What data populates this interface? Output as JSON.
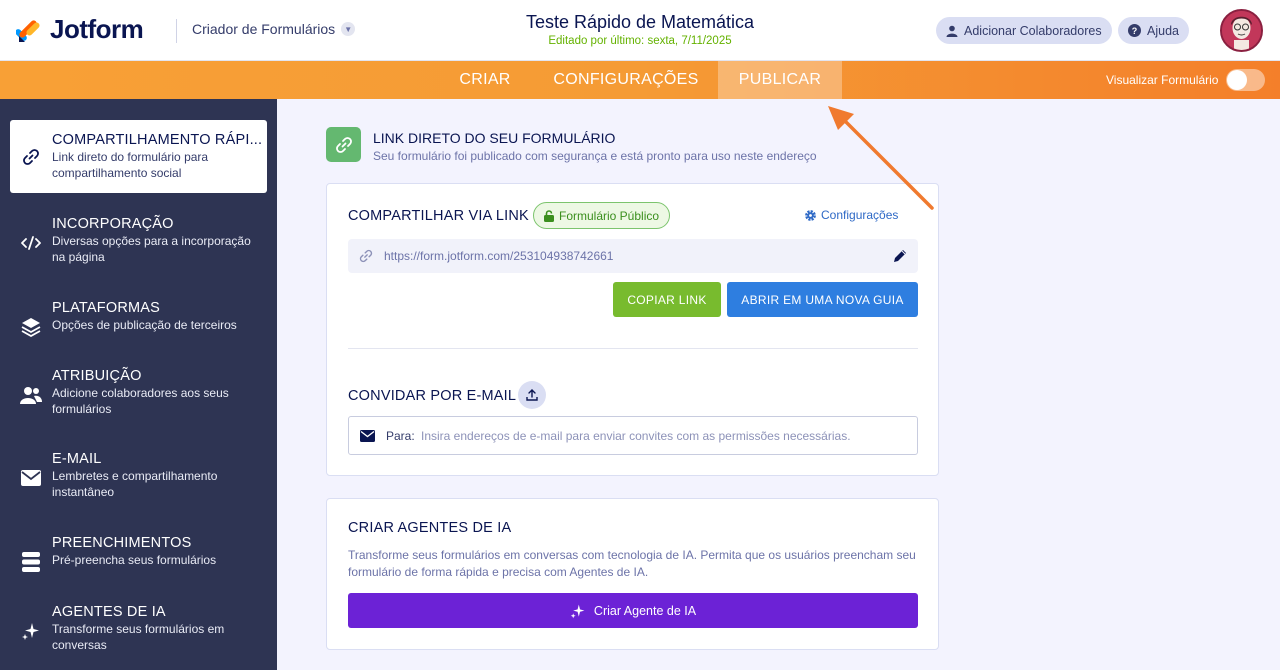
{
  "header": {
    "logo_text": "Jotform",
    "builder_label": "Criador de Formulários",
    "form_title": "Teste Rápido de Matemática",
    "last_edited": "Editado por último: sexta, 7/11/2025",
    "add_collaborators": "Adicionar Colaboradores",
    "help": "Ajuda"
  },
  "nav": {
    "tabs": [
      "CRIAR",
      "CONFIGURAÇÕES",
      "PUBLICAR"
    ],
    "active_tab": "PUBLICAR",
    "preview_label": "Visualizar Formulário",
    "preview_toggle_on": false
  },
  "sidebar": {
    "items": [
      {
        "title": "COMPARTILHAMENTO RÁPI...",
        "desc": "Link direto do formulário para compartilhamento social",
        "icon": "link-icon",
        "active": true
      },
      {
        "title": "INCORPORAÇÃO",
        "desc": "Diversas opções para a incorporação na página",
        "icon": "code-icon"
      },
      {
        "title": "PLATAFORMAS",
        "desc": "Opções de publicação de terceiros",
        "icon": "layers-icon"
      },
      {
        "title": "ATRIBUIÇÃO",
        "desc": "Adicione colaboradores aos seus formulários",
        "icon": "users-icon"
      },
      {
        "title": "E-MAIL",
        "desc": "Lembretes e compartilhamento instantâneo",
        "icon": "envelope-icon"
      },
      {
        "title": "PREENCHIMENTOS",
        "desc": "Pré-preencha seus formulários",
        "icon": "database-icon"
      },
      {
        "title": "AGENTES DE IA",
        "desc": "Transforme seus formulários em conversas",
        "icon": "sparkle-icon"
      }
    ]
  },
  "main": {
    "section_title": "LINK DIRETO DO SEU FORMULÁRIO",
    "section_sub": "Seu formulário foi publicado com segurança e está pronto para uso neste endereço",
    "share": {
      "title": "COMPARTILHAR VIA LINK",
      "badge": "Formulário Público",
      "settings": "Configurações",
      "url": "https://form.jotform.com/253104938742661",
      "copy_button": "COPIAR LINK",
      "open_button": "ABRIR EM UMA NOVA GUIA"
    },
    "invite": {
      "title": "CONVIDAR POR E-MAIL",
      "to_label": "Para:",
      "placeholder": "Insira endereços de e-mail para enviar convites com as permissões necessárias."
    },
    "ai": {
      "title": "CRIAR AGENTES DE IA",
      "desc": "Transforme seus formulários em conversas com tecnologia de IA. Permita que os usuários preencham seu formulário de forma rápida e precisa com Agentes de IA.",
      "button": "Criar Agente de IA"
    }
  },
  "colors": {
    "nav_orange": "#f59b35",
    "sidebar_bg": "#2e3453",
    "green_button": "#78bb2e",
    "blue_button": "#2e7ee0",
    "ai_purple": "#6c22d6",
    "annotation_arrow": "#f07a2f"
  }
}
